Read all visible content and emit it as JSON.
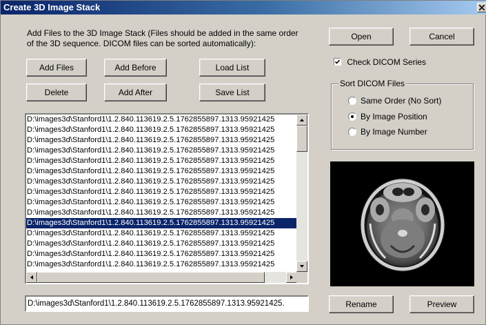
{
  "window": {
    "title": "Create 3D Image Stack"
  },
  "instructions": "Add Files to the 3D Image Stack (Files should be added in the same order of the 3D sequence. DICOM files can be sorted automatically):",
  "buttons": {
    "add_files": "Add Files",
    "add_before": "Add Before",
    "load_list": "Load List",
    "delete": "Delete",
    "add_after": "Add After",
    "save_list": "Save List",
    "open": "Open",
    "cancel": "Cancel",
    "rename": "Rename",
    "preview": "Preview"
  },
  "file_list": {
    "selected_index": 10,
    "items": [
      "D:\\images3d\\Stanford1\\1.2.840.113619.2.5.1762855897.1313.95921425",
      "D:\\images3d\\Stanford1\\1.2.840.113619.2.5.1762855897.1313.95921425",
      "D:\\images3d\\Stanford1\\1.2.840.113619.2.5.1762855897.1313.95921425",
      "D:\\images3d\\Stanford1\\1.2.840.113619.2.5.1762855897.1313.95921425",
      "D:\\images3d\\Stanford1\\1.2.840.113619.2.5.1762855897.1313.95921425",
      "D:\\images3d\\Stanford1\\1.2.840.113619.2.5.1762855897.1313.95921425",
      "D:\\images3d\\Stanford1\\1.2.840.113619.2.5.1762855897.1313.95921425",
      "D:\\images3d\\Stanford1\\1.2.840.113619.2.5.1762855897.1313.95921425",
      "D:\\images3d\\Stanford1\\1.2.840.113619.2.5.1762855897.1313.95921425",
      "D:\\images3d\\Stanford1\\1.2.840.113619.2.5.1762855897.1313.95921425",
      "D:\\images3d\\Stanford1\\1.2.840.113619.2.5.1762855897.1313.95921425",
      "D:\\images3d\\Stanford1\\1.2.840.113619.2.5.1762855897.1313.95921425",
      "D:\\images3d\\Stanford1\\1.2.840.113619.2.5.1762855897.1313.95921425",
      "D:\\images3d\\Stanford1\\1.2.840.113619.2.5.1762855897.1313.95921425",
      "D:\\images3d\\Stanford1\\1.2.840.113619.2.5.1762855897.1313.95921425"
    ]
  },
  "selected_path": "D:\\images3d\\Stanford1\\1.2.840.113619.2.5.1762855897.1313.95921425.",
  "check_dicom": {
    "label": "Check DICOM Series",
    "checked": true
  },
  "sort_group": {
    "label": "Sort DICOM Files",
    "options": [
      {
        "label": "Same Order (No Sort)",
        "selected": false
      },
      {
        "label": "By Image Position",
        "selected": true
      },
      {
        "label": "By Image Number",
        "selected": false
      }
    ]
  },
  "icons": {
    "close": "close-icon",
    "scroll_up": "arrow-up-icon",
    "scroll_down": "arrow-down-icon",
    "scroll_left": "arrow-left-icon",
    "scroll_right": "arrow-right-icon",
    "check": "checkmark-icon"
  },
  "colors": {
    "title_start": "#0a246a",
    "title_end": "#a6caf0",
    "selection": "#0a246a",
    "face": "#d4d0c8"
  }
}
